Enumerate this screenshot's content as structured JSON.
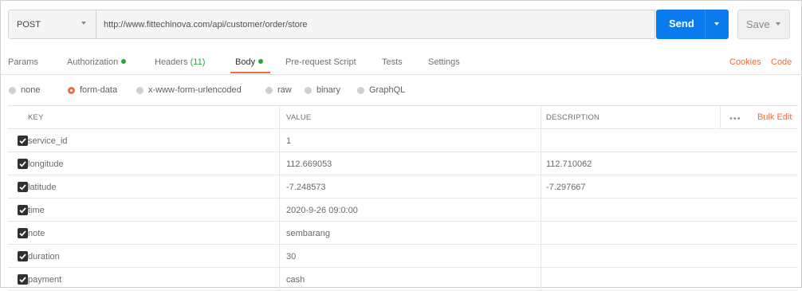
{
  "request": {
    "method": "POST",
    "url": "http://www.fittechinova.com/api/customer/order/store",
    "send_label": "Send",
    "save_label": "Save"
  },
  "tabs": [
    {
      "label": "Params",
      "count": "",
      "dot": false,
      "active": false
    },
    {
      "label": "Authorization",
      "count": "",
      "dot": true,
      "active": false
    },
    {
      "label": "Headers",
      "count": "(11)",
      "dot": false,
      "active": false
    },
    {
      "label": "Body",
      "count": "",
      "dot": true,
      "active": true
    },
    {
      "label": "Pre-request Script",
      "count": "",
      "dot": false,
      "active": false
    },
    {
      "label": "Tests",
      "count": "",
      "dot": false,
      "active": false
    },
    {
      "label": "Settings",
      "count": "",
      "dot": false,
      "active": false
    }
  ],
  "tab_links": {
    "cookies": "Cookies",
    "code": "Code"
  },
  "body_types": [
    {
      "label": "none",
      "selected": false
    },
    {
      "label": "form-data",
      "selected": true
    },
    {
      "label": "x-www-form-urlencoded",
      "selected": false
    },
    {
      "label": "raw",
      "selected": false
    },
    {
      "label": "binary",
      "selected": false
    },
    {
      "label": "GraphQL",
      "selected": false
    }
  ],
  "table": {
    "headers": {
      "key": "KEY",
      "value": "VALUE",
      "description": "DESCRIPTION"
    },
    "more_label": "•••",
    "bulk_edit_label": "Bulk Edit",
    "rows": [
      {
        "key": "service_id",
        "value": "1",
        "description": "",
        "checked": true
      },
      {
        "key": "longitude",
        "value": "112.669053",
        "description": "112.710062",
        "checked": true
      },
      {
        "key": "latitude",
        "value": "-7.248573",
        "description": "-7.297667",
        "checked": true
      },
      {
        "key": "time",
        "value": "2020-9-26 09:0:00",
        "description": "",
        "checked": true
      },
      {
        "key": "note",
        "value": "sembarang",
        "description": "",
        "checked": true
      },
      {
        "key": "duration",
        "value": "30",
        "description": "",
        "checked": true
      },
      {
        "key": "payment",
        "value": "cash",
        "description": "",
        "checked": true
      }
    ]
  },
  "colors": {
    "accent": "#f26b3a",
    "send": "#097bed",
    "status_green": "#27a73f"
  }
}
